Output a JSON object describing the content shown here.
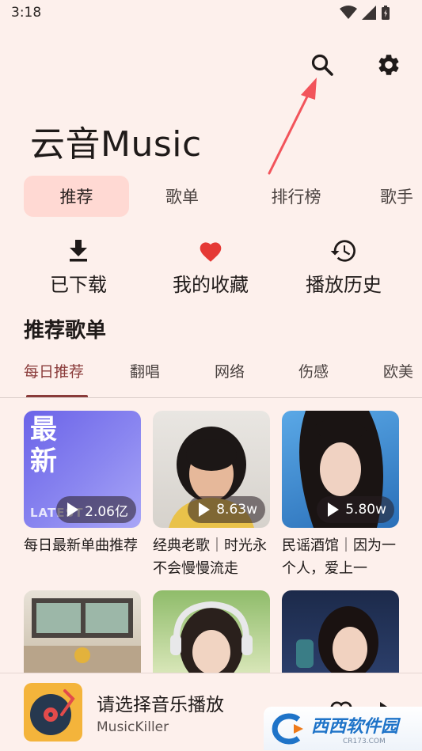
{
  "status_bar": {
    "time": "3:18"
  },
  "header": {
    "app_title": "云音Music",
    "search_icon": "search-icon",
    "settings_icon": "gear-icon"
  },
  "top_tabs": [
    {
      "label": "推荐",
      "active": true
    },
    {
      "label": "歌单",
      "active": false
    },
    {
      "label": "排行榜",
      "active": false
    },
    {
      "label": "歌手",
      "active": false
    }
  ],
  "quick_actions": [
    {
      "label": "已下载",
      "icon": "download-icon"
    },
    {
      "label": "我的收藏",
      "icon": "heart-icon"
    },
    {
      "label": "播放历史",
      "icon": "history-icon"
    }
  ],
  "section": {
    "title": "推荐歌单",
    "tabs": [
      {
        "label": "每日推荐",
        "active": true
      },
      {
        "label": "翻唱",
        "active": false
      },
      {
        "label": "网络",
        "active": false
      },
      {
        "label": "伤感",
        "active": false
      },
      {
        "label": "欧美",
        "active": false
      }
    ]
  },
  "playlists": [
    {
      "title": "每日最新单曲推荐",
      "plays": "2.06亿",
      "cover_text": "最新",
      "cover_sub": "LATEST"
    },
    {
      "title": "经典老歌｜时光永不会慢慢流走",
      "plays": "8.63w"
    },
    {
      "title": "民谣酒馆｜因为一个人，爱上一",
      "plays": "5.80w"
    }
  ],
  "player": {
    "title": "请选择音乐播放",
    "artist": "MusicKiller"
  },
  "watermark": {
    "text": "西西软件园",
    "sub": "CR173.COM"
  },
  "colors": {
    "background": "#fdf0ec",
    "accent": "#8a3b3a",
    "active_tab_bg": "#ffd9d3",
    "heart": "#e53935",
    "annotation_arrow": "#f2545b"
  }
}
